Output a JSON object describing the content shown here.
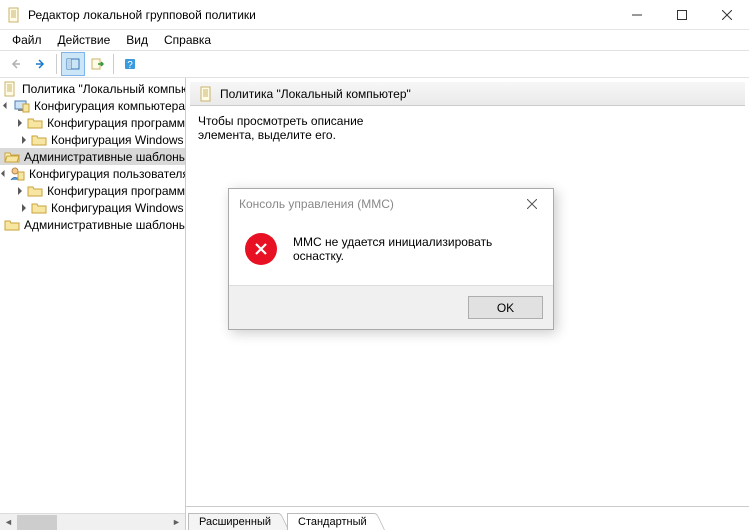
{
  "window": {
    "title": "Редактор локальной групповой политики"
  },
  "menu": {
    "file": "Файл",
    "action": "Действие",
    "view": "Вид",
    "help": "Справка"
  },
  "tree": {
    "root": "Политика \"Локальный компьютер\"",
    "comp_config": "Конфигурация компьютера",
    "user_config": "Конфигурация пользователя",
    "soft_settings": "Конфигурация программ",
    "win_settings": "Конфигурация Windows",
    "admin_templates": "Административные шаблоны"
  },
  "right": {
    "header": "Политика \"Локальный компьютер\"",
    "hint_line1": "Чтобы просмотреть описание",
    "hint_line2": "элемента, выделите его.",
    "tab_extended": "Расширенный",
    "tab_standard": "Стандартный"
  },
  "dialog": {
    "title": "Консоль управления (MMC)",
    "message": "MMC не удается инициализировать оснастку.",
    "ok": "OK"
  }
}
